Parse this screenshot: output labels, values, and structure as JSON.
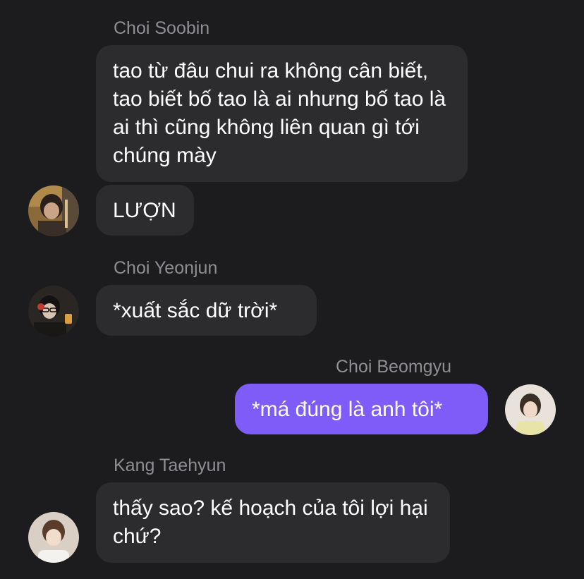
{
  "messages": [
    {
      "sender": "Choi Soobin",
      "bubbles": [
        "tao từ đâu chui ra không cân biết, tao biết bố tao là ai nhưng bố tao là ai thì cũng không liên quan gì tới chúng mày",
        "LƯỢN"
      ],
      "avatar_icon": "avatar-photo-icon",
      "outgoing": false
    },
    {
      "sender": "Choi Yeonjun",
      "bubbles": [
        "*xuất sắc dữ trời*"
      ],
      "avatar_icon": "avatar-photo-icon",
      "outgoing": false
    },
    {
      "sender": "Choi Beomgyu",
      "bubbles": [
        "*má đúng là anh tôi*"
      ],
      "avatar_icon": "avatar-photo-icon",
      "outgoing": true
    },
    {
      "sender": "Kang Taehyun",
      "bubbles": [
        "thấy sao? kế hoạch của tôi lợi hại chứ?"
      ],
      "avatar_icon": "avatar-photo-icon",
      "outgoing": false
    }
  ],
  "colors": {
    "background": "#1c1c1e",
    "incoming_bubble": "#2c2c2e",
    "outgoing_bubble": "#7d5cf8",
    "sender_name": "#8e8e93",
    "text": "#ffffff"
  }
}
